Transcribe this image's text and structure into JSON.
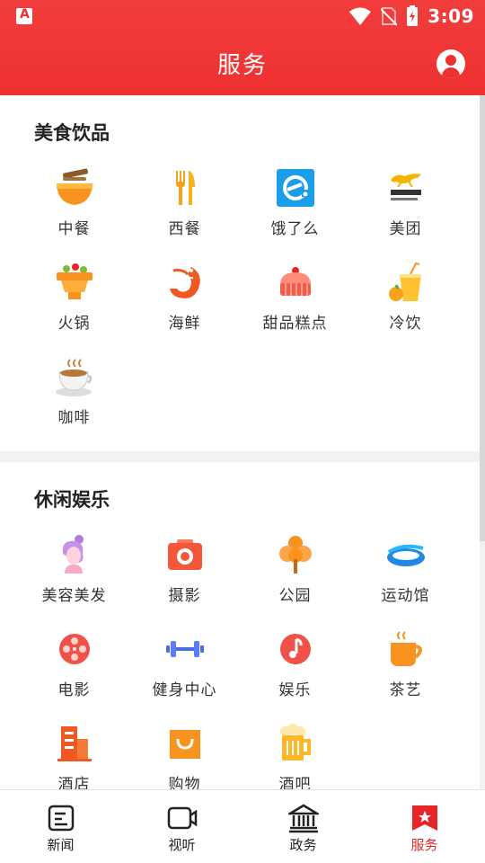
{
  "status_bar": {
    "time": "3:09"
  },
  "header": {
    "title": "服务"
  },
  "sections": [
    {
      "title": "美食饮品",
      "items": [
        {
          "label": "中餐",
          "icon": "noodle-bowl-icon"
        },
        {
          "label": "西餐",
          "icon": "fork-knife-icon"
        },
        {
          "label": "饿了么",
          "icon": "eleme-icon"
        },
        {
          "label": "美团",
          "icon": "meituan-kangaroo-icon"
        },
        {
          "label": "火锅",
          "icon": "hotpot-icon"
        },
        {
          "label": "海鲜",
          "icon": "shrimp-icon"
        },
        {
          "label": "甜品糕点",
          "icon": "cake-icon"
        },
        {
          "label": "冷饮",
          "icon": "cold-drink-icon"
        },
        {
          "label": "咖啡",
          "icon": "coffee-cup-icon"
        }
      ]
    },
    {
      "title": "休闲娱乐",
      "items": [
        {
          "label": "美容美发",
          "icon": "beauty-woman-icon"
        },
        {
          "label": "摄影",
          "icon": "camera-icon"
        },
        {
          "label": "公园",
          "icon": "tree-icon"
        },
        {
          "label": "运动馆",
          "icon": "stadium-icon"
        },
        {
          "label": "电影",
          "icon": "film-reel-icon"
        },
        {
          "label": "健身中心",
          "icon": "dumbbell-icon"
        },
        {
          "label": "娱乐",
          "icon": "music-note-icon"
        },
        {
          "label": "茶艺",
          "icon": "tea-cup-icon"
        },
        {
          "label": "酒店",
          "icon": "hotel-building-icon"
        },
        {
          "label": "购物",
          "icon": "shopping-bag-icon"
        },
        {
          "label": "酒吧",
          "icon": "beer-mug-icon"
        }
      ]
    }
  ],
  "bottom_nav": [
    {
      "label": "新闻",
      "icon": "news-icon",
      "active": false
    },
    {
      "label": "视听",
      "icon": "video-camera-icon",
      "active": false
    },
    {
      "label": "政务",
      "icon": "government-building-icon",
      "active": false
    },
    {
      "label": "服务",
      "icon": "service-star-icon",
      "active": true
    }
  ],
  "colors": {
    "brand": "#ee3030",
    "active_tab": "#e8262a",
    "icon_orange": "#f7931e"
  }
}
